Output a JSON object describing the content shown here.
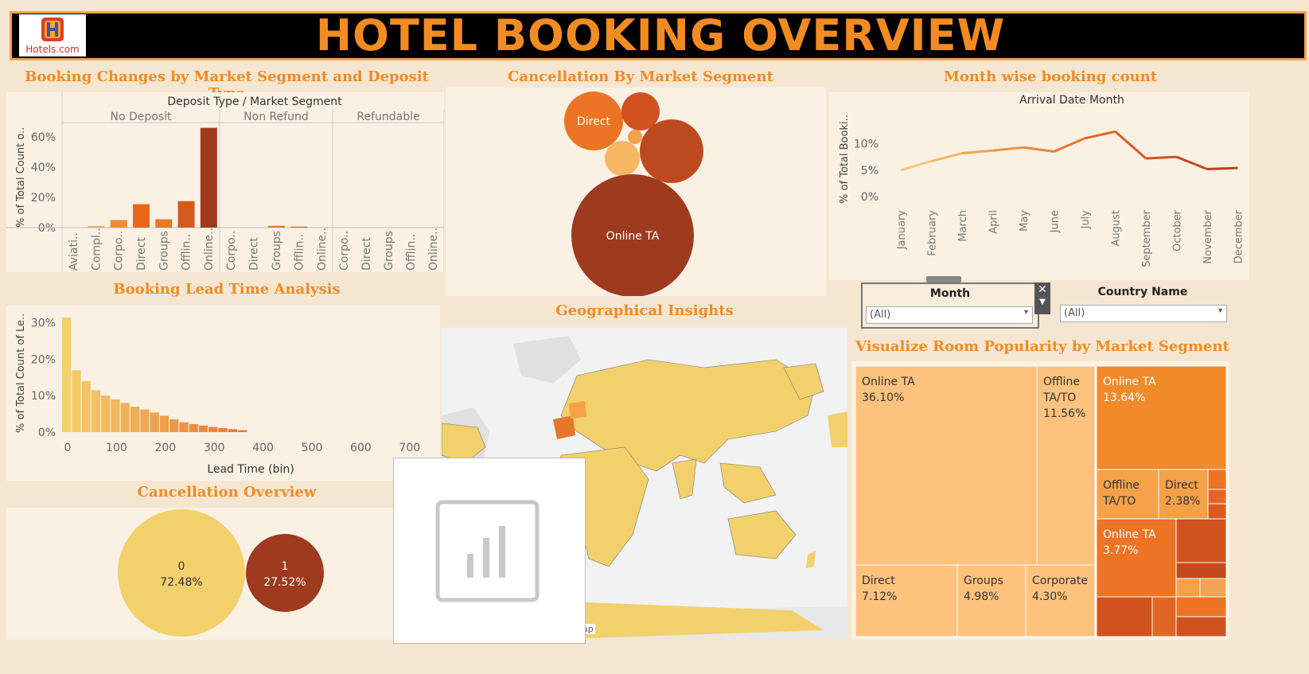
{
  "header": {
    "title": "HOTEL BOOKING OVERVIEW",
    "logo_text": "Hotels.com"
  },
  "sections": {
    "booking_changes": "Booking Changes by Market Segment and Deposit Type",
    "cancellation_segment": "Cancellation By Market Segment",
    "month_wise": "Month wise booking count",
    "lead_time": "Booking Lead Time Analysis",
    "geo": "Geographical Insights",
    "cancel_overview": "Cancellation Overview",
    "room_popularity": "Visualize Room Popularity by Market Segment"
  },
  "filters": {
    "month": {
      "label": "Month",
      "value": "(All)"
    },
    "country": {
      "label": "Country Name",
      "value": "(All)"
    }
  },
  "map_credit": "lap",
  "chart_data": [
    {
      "id": "booking_changes",
      "type": "bar",
      "header": "Deposit Type  /  Market Segment",
      "ylabel": "% of Total Count o..",
      "ylim": [
        0,
        70
      ],
      "yticks": [
        "60%",
        "40%",
        "20%",
        "0%"
      ],
      "groups": [
        {
          "name": "No Deposit",
          "categories": [
            "Aviati..",
            "Compl..",
            "Corpo..",
            "Direct",
            "Groups",
            "Offlin..",
            "Online.."
          ],
          "values": [
            0.3,
            1.0,
            5.0,
            15.5,
            5.5,
            17.5,
            66.0
          ],
          "colors": [
            "#f6c77a",
            "#f4a24a",
            "#ef8b2c",
            "#e8671b",
            "#e8772a",
            "#d65a1e",
            "#a03a1f"
          ]
        },
        {
          "name": "Non Refund",
          "categories": [
            "Corpo..",
            "Direct",
            "Groups",
            "Offlin..",
            "Online.."
          ],
          "values": [
            0,
            0,
            1.2,
            0.6,
            0
          ],
          "colors": [
            "#ef8b2c",
            "#e8671b",
            "#e8772a",
            "#d65a1e",
            "#a03a1f"
          ]
        },
        {
          "name": "Refundable",
          "categories": [
            "Corpo..",
            "Direct",
            "Groups",
            "Offlin..",
            "Online.."
          ],
          "values": [
            0,
            0,
            0,
            0,
            0
          ],
          "colors": [
            "#ef8b2c",
            "#e8671b",
            "#e8772a",
            "#d65a1e",
            "#a03a1f"
          ]
        }
      ]
    },
    {
      "id": "cancellation_segment",
      "type": "bubble",
      "bubbles": [
        {
          "label": "Direct",
          "color": "#ec7424"
        },
        {
          "label": "",
          "color": "#d2521f"
        },
        {
          "label": "",
          "color": "#f4a24a"
        },
        {
          "label": "",
          "color": "#f6b863"
        },
        {
          "label": "",
          "color": "#bd4a1f"
        },
        {
          "label": "Online TA",
          "color": "#9e3a1e"
        }
      ]
    },
    {
      "id": "month_wise",
      "type": "line",
      "title": "Arrival Date Month",
      "ylabel": "% of Total Booki..",
      "yticks": [
        "10%",
        "5%",
        "0%"
      ],
      "ylim": [
        0,
        14
      ],
      "x": [
        "January",
        "February",
        "March",
        "April",
        "May",
        "June",
        "July",
        "August",
        "September",
        "October",
        "November",
        "December"
      ],
      "values": [
        5.0,
        6.7,
        8.2,
        8.7,
        9.3,
        8.5,
        11.0,
        12.3,
        7.2,
        7.5,
        5.2,
        5.4
      ]
    },
    {
      "id": "lead_time",
      "type": "bar",
      "xlabel": "Lead Time (bin)",
      "ylabel": "% of Total Count of Le..",
      "yticks": [
        "30%",
        "20%",
        "10%",
        "0%"
      ],
      "xticks": [
        "0",
        "100",
        "200",
        "300",
        "400",
        "500",
        "600",
        "700"
      ],
      "ylim": [
        0,
        33
      ],
      "bin_width": 20,
      "values": [
        31.5,
        17.0,
        14.0,
        11.5,
        10.0,
        9.0,
        8.0,
        7.0,
        6.2,
        5.4,
        4.5,
        3.5,
        2.7,
        2.2,
        1.8,
        1.4,
        1.1,
        0.8,
        0.5
      ]
    },
    {
      "id": "cancel_overview",
      "type": "bubble",
      "bubbles": [
        {
          "label": "0",
          "value": "72.48%",
          "color": "#f2d06b"
        },
        {
          "label": "1",
          "value": "27.52%",
          "color": "#9e3a1e"
        }
      ]
    },
    {
      "id": "room_popularity",
      "type": "treemap",
      "cells": [
        {
          "label": "Online TA",
          "value": "36.10%",
          "color": "#fdc27d"
        },
        {
          "label": "Offline TA/TO",
          "value": "11.56%",
          "color": "#fdc27d"
        },
        {
          "label": "Direct",
          "value": "7.12%",
          "color": "#fdc27d"
        },
        {
          "label": "Groups",
          "value": "4.98%",
          "color": "#fdc27d"
        },
        {
          "label": "Corporate",
          "value": "4.30%",
          "color": "#fdc27d"
        },
        {
          "label": "Online TA",
          "value": "13.64%",
          "color": "#f08a2a"
        },
        {
          "label": "Offline TA/TO",
          "value": "",
          "color": "#f4a14a"
        },
        {
          "label": "Direct",
          "value": "2.38%",
          "color": "#f4a14a"
        },
        {
          "label": "Online TA",
          "value": "3.77%",
          "color": "#ec7424"
        }
      ]
    }
  ]
}
